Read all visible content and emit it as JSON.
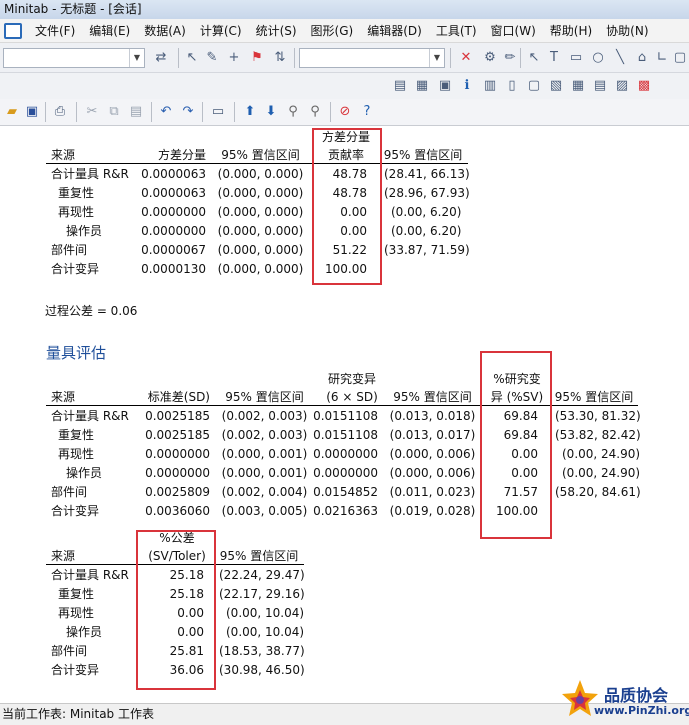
{
  "window": {
    "title": "Minitab - 无标题 - [会话]"
  },
  "menu": [
    "文件(F)",
    "编辑(E)",
    "数据(A)",
    "计算(C)",
    "统计(S)",
    "图形(G)",
    "编辑器(D)",
    "工具(T)",
    "窗口(W)",
    "帮助(H)",
    "协助(N)"
  ],
  "table1": {
    "headers": {
      "source": "来源",
      "varcomp": "方差分量",
      "ci1": "95% 置信区间",
      "contrib_l1": "方差分量",
      "contrib_l2": "贡献率",
      "ci2": "95% 置信区间"
    },
    "rows": [
      {
        "source": "合计量具 R&R",
        "varcomp": "0.0000063",
        "ci1": "(0.000, 0.000)",
        "contrib": "48.78",
        "ci2": "(28.41, 66.13)"
      },
      {
        "source": "重复性",
        "varcomp": "0.0000063",
        "ci1": "(0.000, 0.000)",
        "contrib": "48.78",
        "ci2": "(28.96, 67.93)"
      },
      {
        "source": "再现性",
        "varcomp": "0.0000000",
        "ci1": "(0.000, 0.000)",
        "contrib": "0.00",
        "ci2": "(0.00, 6.20)"
      },
      {
        "source": "操作员",
        "varcomp": "0.0000000",
        "ci1": "(0.000, 0.000)",
        "contrib": "0.00",
        "ci2": "(0.00, 6.20)"
      },
      {
        "source": "部件间",
        "varcomp": "0.0000067",
        "ci1": "(0.000, 0.000)",
        "contrib": "51.22",
        "ci2": "(33.87, 71.59)"
      },
      {
        "source": "合计变异",
        "varcomp": "0.0000130",
        "ci1": "(0.000, 0.000)",
        "contrib": "100.00",
        "ci2": ""
      }
    ]
  },
  "tolerance_text": "过程公差 = 0.06",
  "gage_eval_title": "量具评估",
  "table2": {
    "headers": {
      "source": "来源",
      "sd": "标准差(SD)",
      "ci1": "95% 置信区间",
      "sv_l1": "研究变异",
      "sv_l2": "(6 × SD)",
      "ci2": "95% 置信区间",
      "pct_l1": "%研究变",
      "pct_l2": "异 (%SV)",
      "ci3": "95% 置信区间"
    },
    "rows": [
      {
        "source": "合计量具 R&R",
        "sd": "0.0025185",
        "ci1": "(0.002, 0.003)",
        "sv": "0.0151108",
        "ci2": "(0.013, 0.018)",
        "pct": "69.84",
        "ci3": "(53.30, 81.32)"
      },
      {
        "source": "重复性",
        "sd": "0.0025185",
        "ci1": "(0.002, 0.003)",
        "sv": "0.0151108",
        "ci2": "(0.013, 0.017)",
        "pct": "69.84",
        "ci3": "(53.82, 82.42)"
      },
      {
        "source": "再现性",
        "sd": "0.0000000",
        "ci1": "(0.000, 0.001)",
        "sv": "0.0000000",
        "ci2": "(0.000, 0.006)",
        "pct": "0.00",
        "ci3": "(0.00, 24.90)"
      },
      {
        "source": "操作员",
        "sd": "0.0000000",
        "ci1": "(0.000, 0.001)",
        "sv": "0.0000000",
        "ci2": "(0.000, 0.006)",
        "pct": "0.00",
        "ci3": "(0.00, 24.90)"
      },
      {
        "source": "部件间",
        "sd": "0.0025809",
        "ci1": "(0.002, 0.004)",
        "sv": "0.0154852",
        "ci2": "(0.011, 0.023)",
        "pct": "71.57",
        "ci3": "(58.20, 84.61)"
      },
      {
        "source": "合计变异",
        "sd": "0.0036060",
        "ci1": "(0.003, 0.005)",
        "sv": "0.0216363",
        "ci2": "(0.019, 0.028)",
        "pct": "100.00",
        "ci3": ""
      }
    ]
  },
  "table3": {
    "headers": {
      "source": "来源",
      "tol_l1": "%公差",
      "tol_l2": "(SV/Toler)",
      "ci": "95% 置信区间"
    },
    "rows": [
      {
        "source": "合计量具 R&R",
        "tol": "25.18",
        "ci": "(22.24, 29.47)"
      },
      {
        "source": "重复性",
        "tol": "25.18",
        "ci": "(22.17, 29.16)"
      },
      {
        "source": "再现性",
        "tol": "0.00",
        "ci": "(0.00, 10.04)"
      },
      {
        "source": "操作员",
        "tol": "0.00",
        "ci": "(0.00, 10.04)"
      },
      {
        "source": "部件间",
        "tol": "25.81",
        "ci": "(18.53, 38.77)"
      },
      {
        "source": "合计变异",
        "tol": "36.06",
        "ci": "(30.98, 46.50)"
      }
    ]
  },
  "status": "当前工作表: Minitab 工作表",
  "watermark": {
    "title": "品质协会",
    "url": "www.PinZhi.org"
  },
  "colors": {
    "highlight": "#d9343b",
    "section_title": "#1f4f9a"
  }
}
